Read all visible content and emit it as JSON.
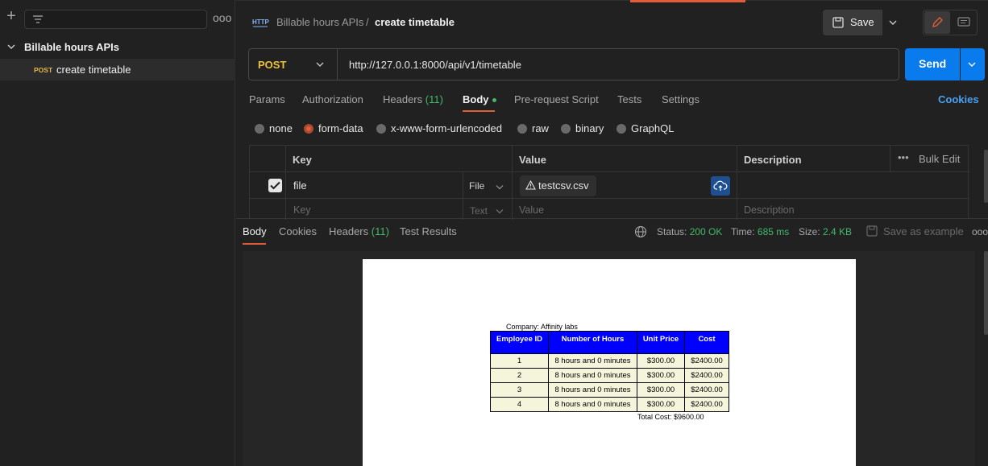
{
  "sidebar": {
    "more_label": "ooo",
    "collection_name": "Billable hours APIs",
    "request_method": "POST",
    "request_name": "create timetable"
  },
  "header": {
    "breadcrumb_parent": "Billable hours APIs",
    "breadcrumb_sep": "/",
    "breadcrumb_current": "create timetable",
    "save_label": "Save",
    "http_icon_text": "HTTP"
  },
  "request": {
    "method": "POST",
    "url": "http://127.0.0.1:8000/api/v1/timetable",
    "send_label": "Send"
  },
  "req_tabs": {
    "params": "Params",
    "authorization": "Authorization",
    "headers": "Headers",
    "headers_count": "(11)",
    "body": "Body",
    "prerequest": "Pre-request Script",
    "tests": "Tests",
    "settings": "Settings",
    "cookies": "Cookies"
  },
  "body_types": {
    "none": "none",
    "form_data": "form-data",
    "urlencoded": "x-www-form-urlencoded",
    "raw": "raw",
    "binary": "binary",
    "graphql": "GraphQL",
    "selected": "form-data"
  },
  "params_table": {
    "col_key": "Key",
    "col_value": "Value",
    "col_description": "Description",
    "bulk_edit": "Bulk Edit",
    "bulk_dots": "•••",
    "row": {
      "checked": true,
      "key": "file",
      "type": "File",
      "value": "testcsv.csv"
    },
    "placeholder": {
      "key": "Key",
      "type": "Text",
      "value": "Value",
      "description": "Description"
    }
  },
  "response": {
    "tabs": {
      "body": "Body",
      "cookies": "Cookies",
      "headers": "Headers",
      "headers_count": "(11)",
      "test_results": "Test Results"
    },
    "status_label": "Status:",
    "status_value": "200 OK",
    "time_label": "Time:",
    "time_value": "685 ms",
    "size_label": "Size:",
    "size_value": "2.4 KB",
    "save_example": "Save as example",
    "more": "ooo"
  },
  "document": {
    "company": "Company: Affinity labs",
    "headers": [
      "Employee ID",
      "Number of Hours",
      "Unit Price",
      "Cost"
    ],
    "rows": [
      [
        "1",
        "8 hours and 0 minutes",
        "$300.00",
        "$2400.00"
      ],
      [
        "2",
        "8 hours and 0 minutes",
        "$300.00",
        "$2400.00"
      ],
      [
        "3",
        "8 hours and 0 minutes",
        "$300.00",
        "$2400.00"
      ],
      [
        "4",
        "8 hours and 0 minutes",
        "$300.00",
        "$2400.00"
      ]
    ],
    "total": "Total Cost: $9600.00"
  },
  "colors": {
    "accent": "#e05d38",
    "send_blue": "#097bed",
    "method_post": "#f0c23b",
    "success_green": "#43b86a",
    "table_header_blue": "#0000ff",
    "table_cell_beige": "#f5f5dc"
  }
}
